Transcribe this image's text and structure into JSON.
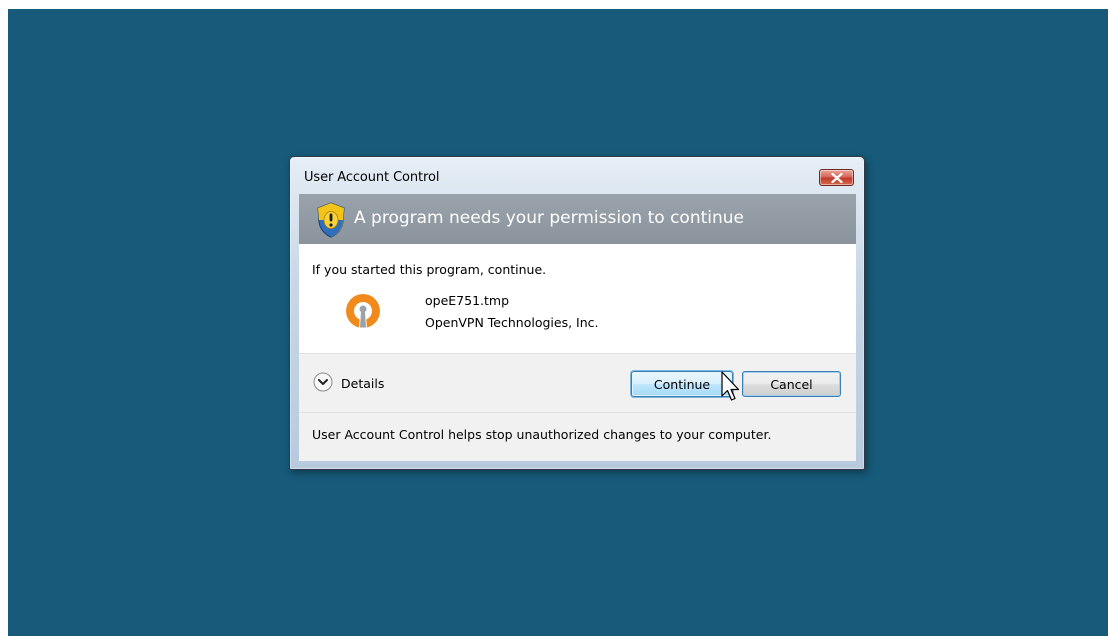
{
  "window": {
    "title": "User Account Control"
  },
  "banner": {
    "icon": "uac-shield-icon",
    "text": "A program needs your permission to continue"
  },
  "content": {
    "intro": "If you started this program, continue.",
    "program": {
      "icon": "openvpn-icon",
      "name": "opeE751.tmp",
      "publisher": "OpenVPN Technologies, Inc."
    }
  },
  "actions": {
    "details_label": "Details",
    "continue_label": "Continue",
    "cancel_label": "Cancel"
  },
  "footer": {
    "text": "User Account Control helps stop unauthorized changes to your computer."
  },
  "colors": {
    "desktop_background": "#175a7a",
    "banner_background": "#8f989f",
    "openvpn_orange": "#f08a1c"
  }
}
